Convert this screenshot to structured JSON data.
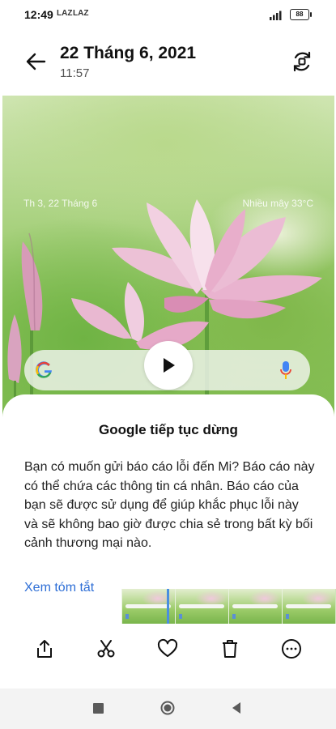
{
  "status_bar": {
    "time": "12:49",
    "notif_1": "LAZ",
    "notif_2": "LAZ",
    "battery": "88"
  },
  "header": {
    "title": "22 Tháng 6, 2021",
    "subtitle": "11:57",
    "back_icon": "arrow-left-icon",
    "rotate_icon": "rotate-screen-icon"
  },
  "photo": {
    "widget_date": "Th 3, 22 Tháng 6",
    "widget_weather": "Nhiều mây  33°C",
    "search_logo": "google-g-icon",
    "mic_icon": "microphone-icon",
    "play_icon": "play-icon"
  },
  "dialog": {
    "title": "Google tiếp tục dừng",
    "message": "Bạn có muốn gửi báo cáo lỗi đến Mi? Báo cáo này có thể chứa các thông tin cá nhân. Báo cáo của bạn sẽ được sử dụng để giúp khắc phục lỗi này và sẽ không bao giờ được chia sẻ trong bất kỳ bối cảnh thương mại nào.",
    "link": "Xem tóm tắt"
  },
  "toolbar": [
    "share-icon",
    "scissors-icon",
    "heart-icon",
    "trash-icon",
    "more-icon"
  ],
  "navbar": [
    "recents-square-icon",
    "home-circle-icon",
    "back-triangle-icon"
  ],
  "colors": {
    "accent_link": "#2f6fd6",
    "timeline_cursor": "#4a8ee0",
    "lotus_pink": "#e8a6c9"
  }
}
